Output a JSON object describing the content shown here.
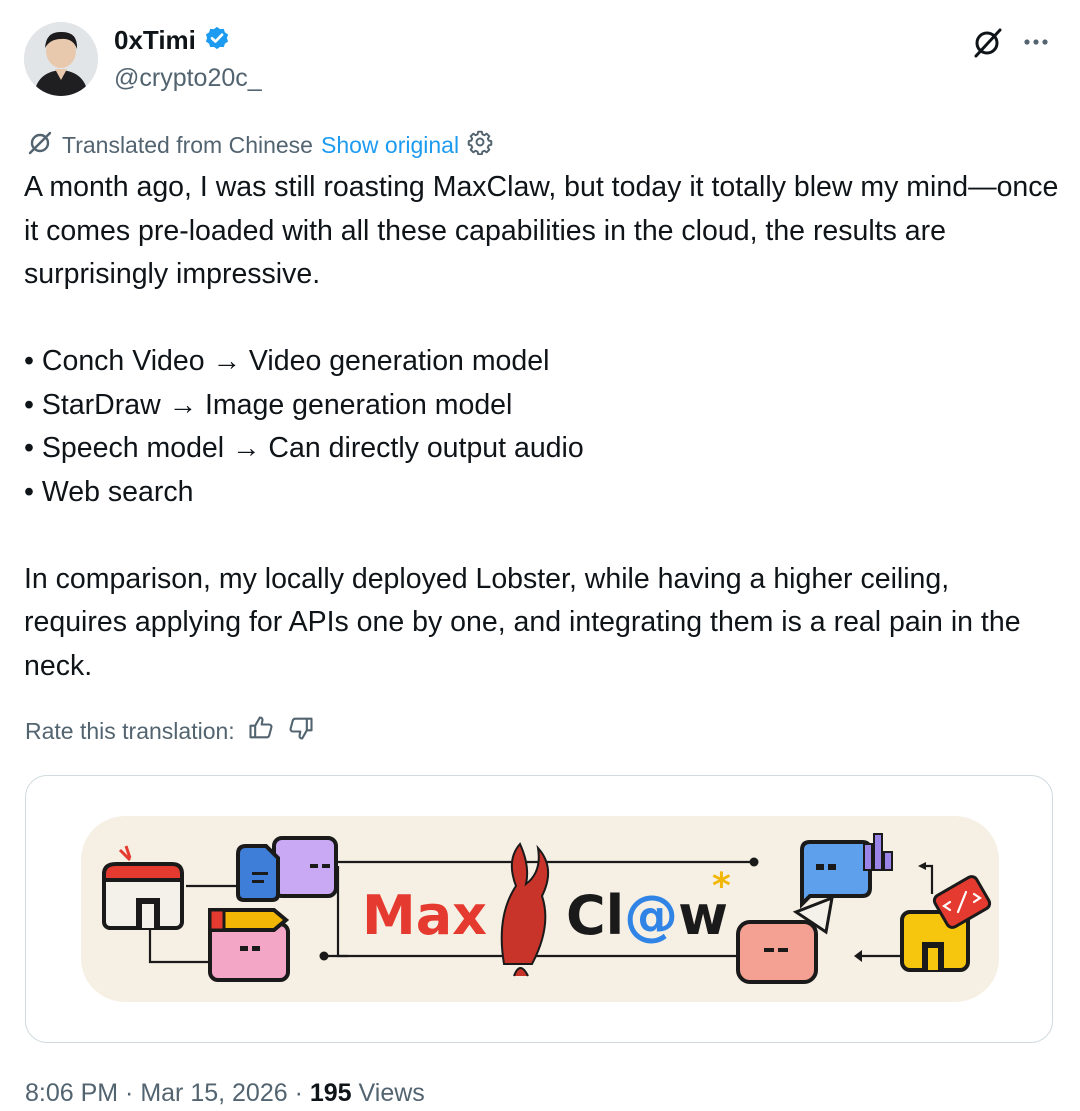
{
  "author": {
    "name": "0xTimi",
    "handle": "@crypto20c_",
    "verified": true
  },
  "icons": {
    "grok": "grok-icon",
    "more": "more-icon",
    "verified": "verified-badge-icon",
    "settings": "gear-icon",
    "thumbs_up": "thumbs-up-icon",
    "thumbs_down": "thumbs-down-icon"
  },
  "translation": {
    "label": "Translated from Chinese",
    "show_original": "Show original",
    "rate_label": "Rate this translation:"
  },
  "post": {
    "paragraph1": "A month ago, I was still roasting MaxClaw, but today it totally blew my mind—once it comes pre-loaded with all these capabilities in the cloud, the results are surprisingly impressive.",
    "bullets": [
      "• Conch Video → Video generation model",
      "• StarDraw → Image generation model",
      "• Speech model → Can directly output audio",
      "• Web search"
    ],
    "paragraph2": "In comparison, my locally deployed Lobster, while having a higher ceiling, requires applying for APIs one by one, and integrating them is a real pain in the neck."
  },
  "card_image": {
    "logo_part1": "Max",
    "logo_part2": "Cl@w",
    "logo_part2_a": "Cl",
    "logo_part2_at": "@",
    "logo_part2_b": "w",
    "asterisk": "*",
    "colors": {
      "max_red": "#e53a2f",
      "claw_black": "#1a1a1a",
      "at_blue": "#2f84e6",
      "asterisk_yellow": "#f2b705",
      "banner_bg": "#f6efe4"
    }
  },
  "footer": {
    "time": "8:06 PM",
    "sep1": " · ",
    "date": "Mar 15, 2026",
    "sep2": " · ",
    "views_count": "195",
    "views_label": " Views"
  },
  "colors": {
    "text_primary": "#0f1419",
    "text_secondary": "#536471",
    "link": "#1d9bf0",
    "border": "#cfd9de"
  }
}
